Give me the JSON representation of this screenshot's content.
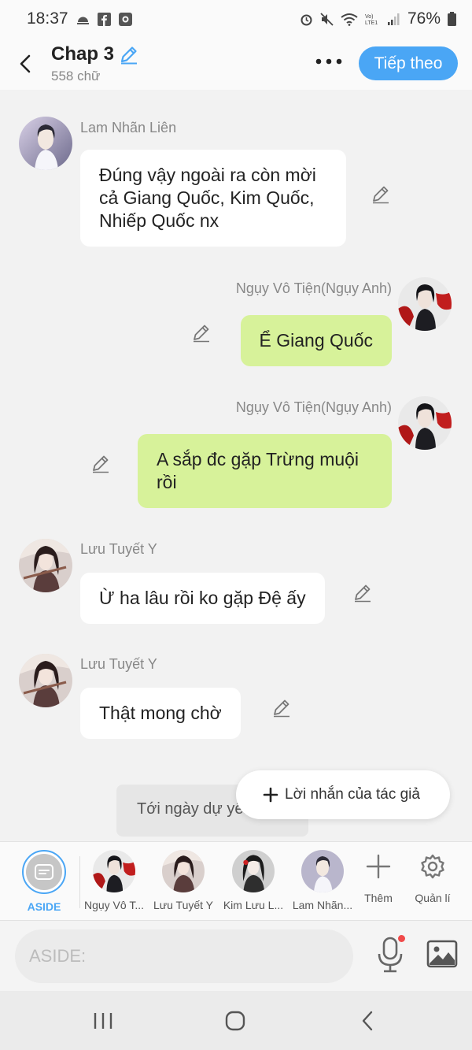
{
  "status_bar": {
    "time": "18:37",
    "battery": "76%"
  },
  "header": {
    "title": "Chap 3",
    "word_count": "558 chữ",
    "next_label": "Tiếp theo"
  },
  "messages": [
    {
      "sender": "Lam Nhãn Liên",
      "text": "Đúng vậy ngoài ra còn mời cả Giang Quốc, Kim Quốc, Nhiếp Quốc nx",
      "side": "left"
    },
    {
      "sender": "Ngụy Vô Tiện(Ngụy Anh)",
      "text": "Ể Giang Quốc",
      "side": "right"
    },
    {
      "sender": "Ngụy Vô Tiện(Ngụy Anh)",
      "text": "A sắp đc gặp Trừng muội rồi",
      "side": "right"
    },
    {
      "sender": "Lưu Tuyết Y",
      "text": "Ừ ha lâu rồi ko gặp Đệ ấy",
      "side": "left"
    },
    {
      "sender": "Lưu Tuyết Y",
      "text": "Thật mong chờ",
      "side": "left"
    }
  ],
  "narration_text": "Tới ngày dự yến",
  "author_note_label": "Lời nhắn của tác giả",
  "characters": [
    {
      "label": "ASIDE"
    },
    {
      "label": "Ngụy Vô T..."
    },
    {
      "label": "Lưu Tuyết Y"
    },
    {
      "label": "Kim Lưu L..."
    },
    {
      "label": "Lam Nhãn..."
    }
  ],
  "actions": {
    "add_label": "Thêm",
    "manage_label": "Quản lí"
  },
  "input": {
    "placeholder": "ASIDE:"
  },
  "colors": {
    "accent": "#4aa6f5",
    "outgoing_bubble": "#d7f29a",
    "incoming_bubble": "#ffffff",
    "background": "#f2f2f2"
  }
}
